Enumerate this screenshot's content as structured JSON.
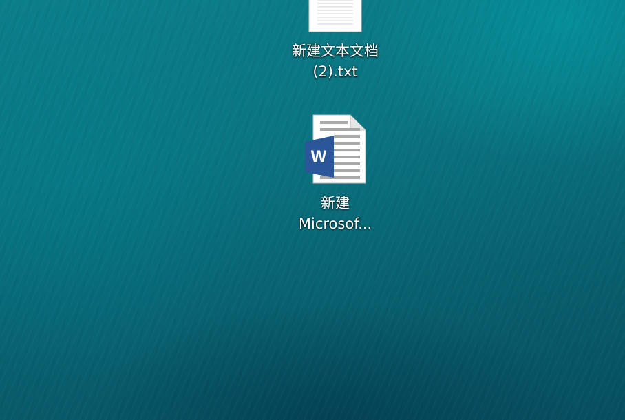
{
  "desktop": {
    "icons": [
      {
        "name_line1": "新建文本文档",
        "name_line2": "(2).txt",
        "icon": "text-document-icon"
      },
      {
        "name_line1": "新建",
        "name_line2": "Microsof...",
        "icon": "word-document-icon",
        "badge_letter": "W"
      }
    ]
  },
  "colors": {
    "desktop_background": "#0a7581",
    "word_badge": "#2b579a"
  }
}
